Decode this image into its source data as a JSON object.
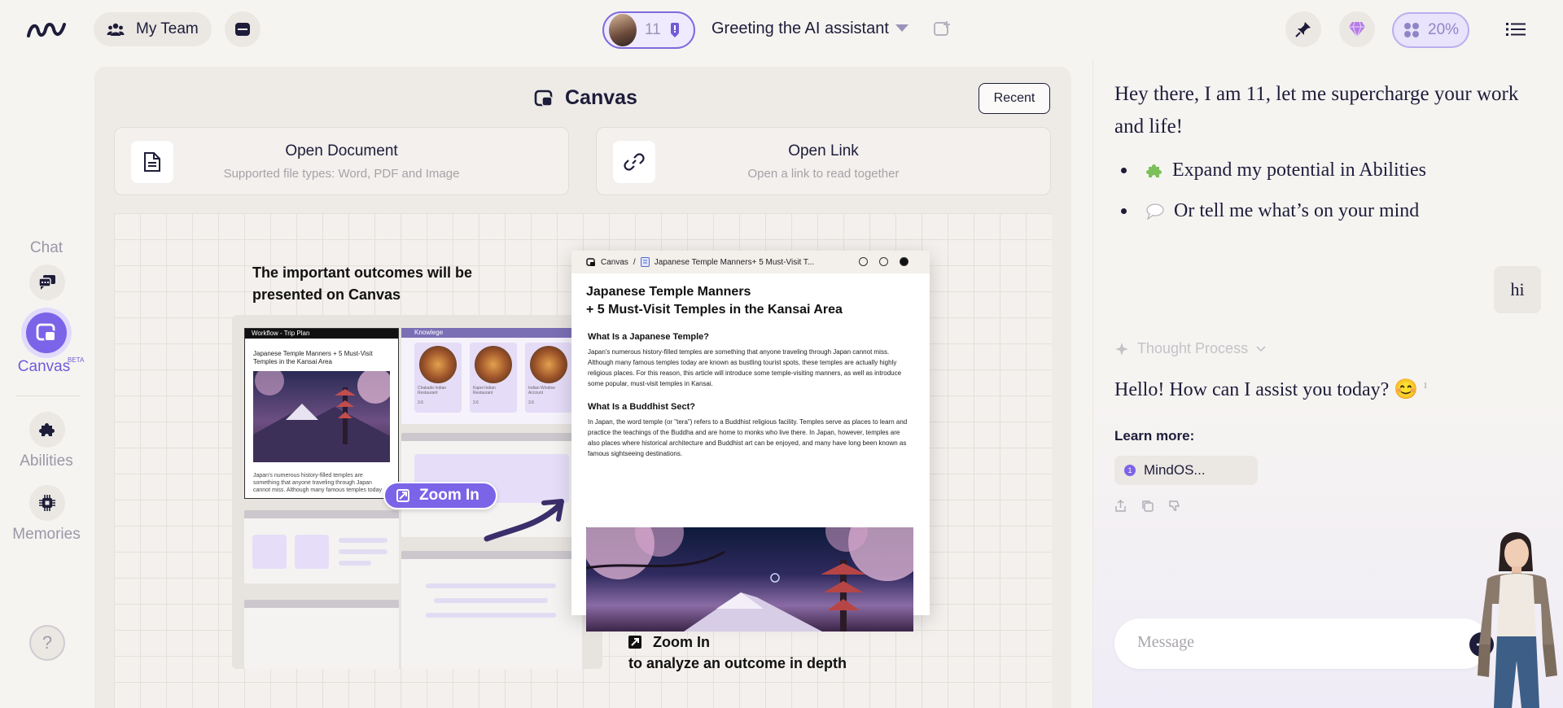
{
  "topbar": {
    "team_label": "My Team",
    "agent_number": "11",
    "chat_title": "Greeting the AI assistant",
    "usage_percent": "20%"
  },
  "rail": {
    "chat_label": "Chat",
    "canvas_label": "Canvas",
    "canvas_badge": "BETA",
    "abilities_label": "Abilities",
    "memories_label": "Memories",
    "help_label": "?"
  },
  "canvas": {
    "title": "Canvas",
    "recent_label": "Recent",
    "open_document": {
      "title": "Open Document",
      "subtitle": "Supported file types: Word, PDF and Image"
    },
    "open_link": {
      "title": "Open Link",
      "subtitle": "Open a link to read together"
    },
    "outcome_caption": "The important outcomes will be presented on Canvas",
    "board": {
      "workflow_header": "Workflow - Trip Plan",
      "workflow_title": "Japanese Temple Manners + 5 Must-Visit Temples in the Kansai Area",
      "workflow_text": "Japan's numerous history-filled temples are something that anyone traveling through Japan cannot miss. Although many famous temples today",
      "knowledge_header": "Knowlege",
      "foods": [
        {
          "name": "Chakade Indian Restaurant",
          "score": "3.6"
        },
        {
          "name": "Kapoi Indian Restaurant",
          "score": "3.6"
        },
        {
          "name": "Indian Window Account",
          "score": "3.6"
        }
      ]
    },
    "zoom_badge": "Zoom In",
    "doc": {
      "crumb_root": "Canvas",
      "crumb_sep": "/",
      "crumb_doc": "Japanese Temple Manners+ 5 Must-Visit T...",
      "title_line1": "Japanese Temple Manners",
      "title_line2": "+ 5 Must-Visit Temples in the Kansai Area",
      "section1_title": "What Is a Japanese Temple?",
      "section1_text": "Japan's numerous history-filled temples are something that anyone traveling through Japan cannot miss. Although many famous temples today are known as bustling tourist spots, these temples are actually highly religious places. For this reason, this article will introduce some temple-visiting manners, as well as introduce some popular, must-visit temples in Kansai.",
      "section2_title": "What Is a Buddhist Sect?",
      "section2_text": "In Japan, the word temple (or \"tera\") refers to a Buddhist religious facility. Temples serve as places to learn and practice the teachings of the Buddha and are home to monks who live there. In Japan, however, temples are also places where historical architecture and Buddhist art can be enjoyed, and many have long been known as famous sightseeing destinations."
    },
    "zoom_caption_title": "Zoom In",
    "zoom_caption_sub": "to analyze an outcome in depth"
  },
  "chat": {
    "greeting": "Hey there, I am 11, let me supercharge your work and life!",
    "bullets": [
      "Expand my potential in Abilities",
      "Or tell me what’s on your mind"
    ],
    "user_message": "hi",
    "thought_label": "Thought Process",
    "reply": "Hello! How can I assist you today? 😊",
    "reply_ref": "1",
    "learn_more": "Learn more:",
    "source_num": "1",
    "source_label": "MindOS...",
    "input_placeholder": "Message"
  },
  "colors": {
    "accent": "#7b64e8",
    "ink": "#1d1d3a",
    "background": "#f6f4f1"
  }
}
